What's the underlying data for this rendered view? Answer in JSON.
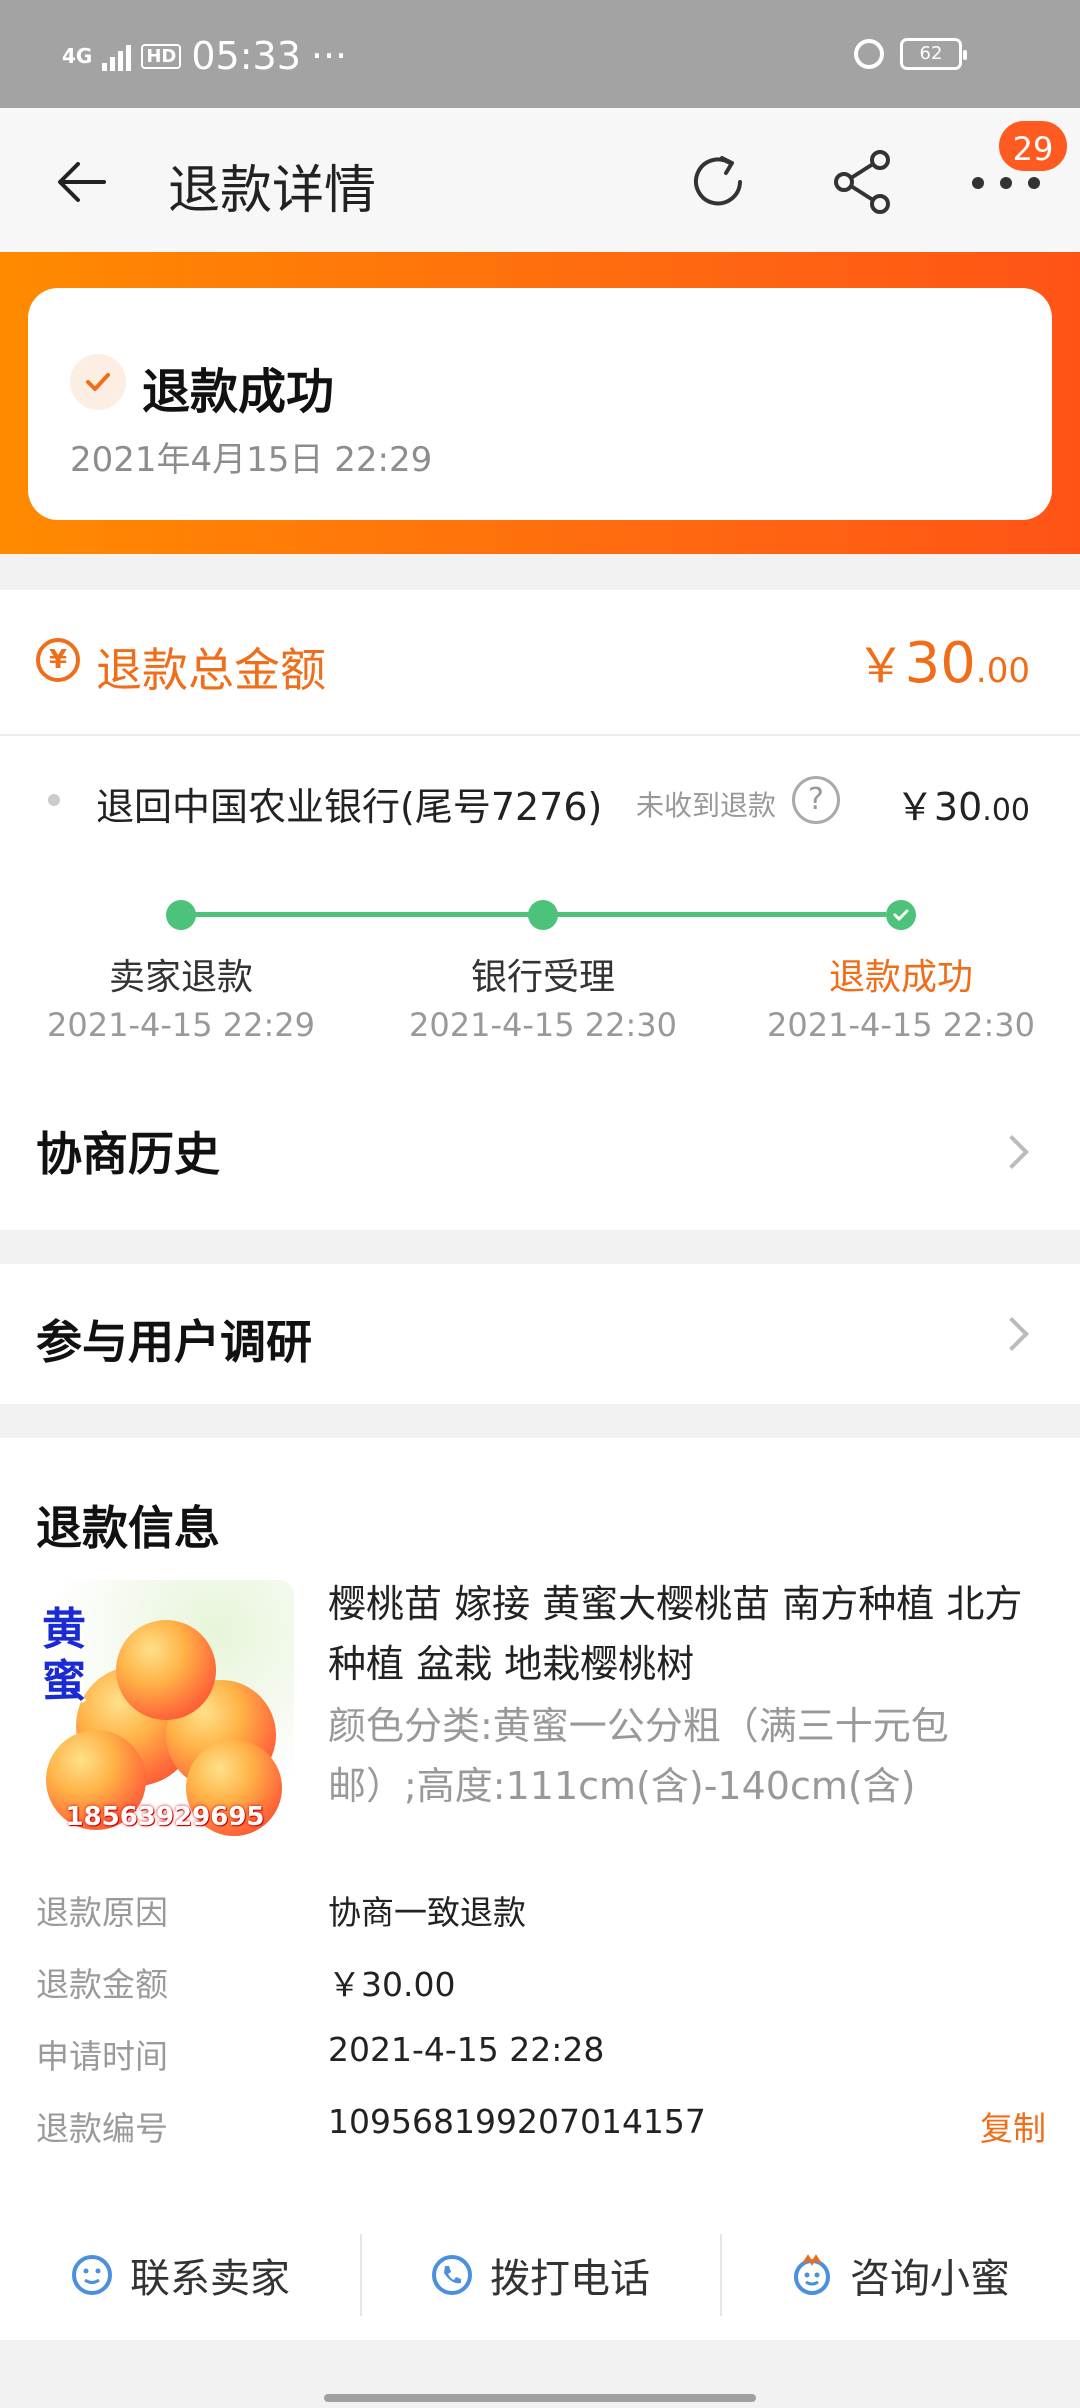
{
  "status_bar": {
    "network": "4G",
    "hd": "HD",
    "time": "05:33",
    "more": "···",
    "battery": "62"
  },
  "nav": {
    "title": "退款详情",
    "badge": "29"
  },
  "hero": {
    "status": "退款成功",
    "time": "2021年4月15日 22:29"
  },
  "total": {
    "label": "退款总金额",
    "symbol": "￥",
    "int": "30",
    "dec": ".00",
    "icon": "¥"
  },
  "bank": {
    "name": "退回中国农业银行(尾号7276)",
    "hint": "未收到退款",
    "help": "?",
    "symbol": "￥",
    "int": "30",
    "dec": ".00"
  },
  "progress": {
    "steps": [
      {
        "label": "卖家退款",
        "time": "2021-4-15 22:29"
      },
      {
        "label": "银行受理",
        "time": "2021-4-15 22:30"
      },
      {
        "label": "退款成功",
        "time": "2021-4-15 22:30"
      }
    ]
  },
  "history": {
    "title": "协商历史"
  },
  "survey": {
    "title": "参与用户调研"
  },
  "info": {
    "title": "退款信息",
    "product": {
      "thumb_text": "黄蜜",
      "thumb_phone": "18563929695",
      "title": "樱桃苗 嫁接 黄蜜大樱桃苗 南方种植 北方种植 盆栽 地栽樱桃树",
      "spec": "颜色分类:黄蜜一公分粗（满三十元包邮）;高度:111cm(含)-140cm(含)"
    },
    "rows": [
      {
        "key": "退款原因",
        "value": "协商一致退款"
      },
      {
        "key": "退款金额",
        "value": "￥30.00"
      },
      {
        "key": "申请时间",
        "value": "2021-4-15 22:28"
      },
      {
        "key": "退款编号",
        "value": "109568199207014157"
      }
    ],
    "copy": "复制"
  },
  "actions": {
    "contact": "联系卖家",
    "call": "拨打电话",
    "consult": "咨询小蜜"
  },
  "colors": {
    "accent": "#f06d1a",
    "green": "#4dc27a",
    "hero_start": "#ff8a00",
    "hero_end": "#ff5316"
  }
}
